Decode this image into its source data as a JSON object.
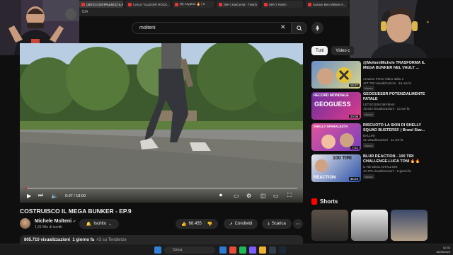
{
  "browser": {
    "tabs": [
      {
        "label": "(3572) COSTRUISCO IL M...",
        "active": true
      },
      {
        "label": "Cerca \"ALLEGRI ROCK...",
        "active": false
      },
      {
        "label": "(6) Cryptos 🔥 | X",
        "active": false
      },
      {
        "label": "(99+) KaiCenat - Twitch",
        "active": false
      },
      {
        "label": "(99+) Twitch",
        "active": false
      },
      {
        "label": "Kanam Ben Mihani H...",
        "active": false
      }
    ],
    "bookmarks_text": "IDA"
  },
  "search": {
    "query": "molteni",
    "clear_icon": "close-icon",
    "search_icon": "search-icon",
    "mic_icon": "mic-icon"
  },
  "player": {
    "time": "0:07 / 18:00",
    "progress": 0.006
  },
  "video": {
    "title": "COSTRUISCO IL MEGA BUNKER - EP.9",
    "channel": "Michele Molteni",
    "verified": "✔",
    "subscribers": "1,31 Mln di iscritti",
    "subscribe_label": "Iscritto",
    "likes": "68.455",
    "share_label": "Condividi",
    "download_label": "Scarica",
    "more_label": "⋯",
    "views": "805.710 visualizzazioni",
    "date": "1 giorno fa",
    "trending": "#3 su Tendenze"
  },
  "sidebar": {
    "chips": [
      "Tutti",
      "Video c"
    ],
    "recommendations": [
      {
        "title": "@MolteniMichele TRASFORMA IL MEGA BUNKER NEL VAULT ...",
        "channel": "Amazon Prime Video Italia ✔",
        "meta": "427.792 visualizzazioni · 16 ore fa",
        "badge": "Nuovo",
        "duration": "19:27"
      },
      {
        "title": "GEOGUESSR POTENZIALMENTE FATALE",
        "channel": "LETSGOSKOMYMAN",
        "meta": "15.824 visualizzazioni · 13 ore fa",
        "badge": "Nuovo",
        "duration": "20:08",
        "thumb_text": "RECORD MONDIALE",
        "thumb_text2": "GEOGUESS"
      },
      {
        "title": "RISCUOTO LA SKIN DI SHELLY SQUAD BUSTERS!! | Brawl Star...",
        "channel": "BALLINI",
        "meta": "41 visualizzazioni · 11 ore fa",
        "badge": "Nuovo",
        "duration": "7:21",
        "thumb_text": "SHELLY SPARALESTA"
      },
      {
        "title": "BLUR REACTION - 100 TIRI CHALLENGE.LUCA TONI 🔥🔥",
        "channel": "IL RE DEGLI STALLONI",
        "meta": "47.475 visualizzazioni · 5 giorni fa",
        "badge": "Nuovo",
        "duration": "45:23",
        "thumb_text": "100 TIRI",
        "thumb_text2": "REACTION"
      }
    ],
    "shorts_label": "Shorts"
  },
  "taskbar": {
    "search_placeholder": "Cerca",
    "time": "02:33",
    "date": "16/05/2024"
  },
  "colors": {
    "accent": "#ff0000",
    "background": "#0f0f0f",
    "chip": "#272727"
  }
}
